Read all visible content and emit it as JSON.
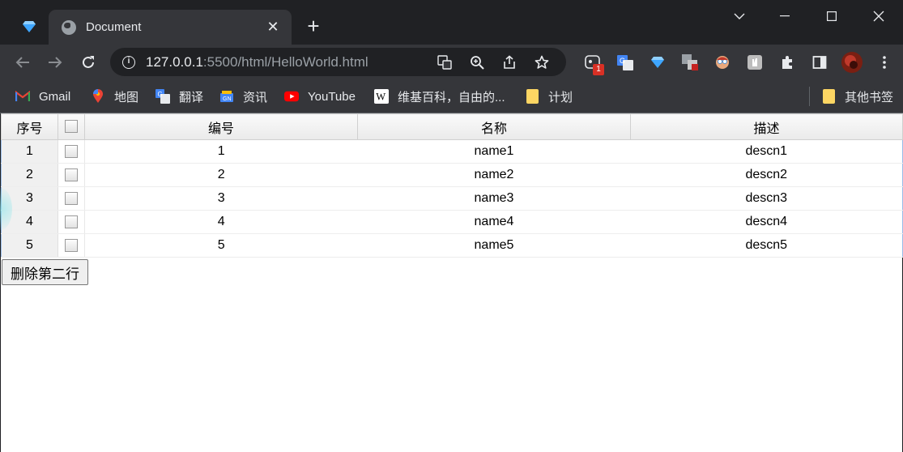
{
  "browser": {
    "tab_title": "Document",
    "url_host": "127.0.0.1",
    "url_rest": ":5500/html/HelloWorld.html",
    "ext_badge": "1",
    "bookmarks": [
      {
        "label": "Gmail",
        "icon": "gmail-icon"
      },
      {
        "label": "地图",
        "icon": "maps-icon"
      },
      {
        "label": "翻译",
        "icon": "translate-icon"
      },
      {
        "label": "资讯",
        "icon": "news-icon"
      },
      {
        "label": "YouTube",
        "icon": "youtube-icon"
      },
      {
        "label": "维基百科，自由的...",
        "icon": "wikipedia-icon"
      },
      {
        "label": "计划",
        "icon": "folder-icon"
      }
    ],
    "other_bookmarks": "其他书签"
  },
  "grid": {
    "headers": {
      "rownum": "序号",
      "id": "编号",
      "name": "名称",
      "desc": "描述"
    },
    "rows": [
      {
        "rownum": "1",
        "id": "1",
        "name": "name1",
        "desc": "descn1"
      },
      {
        "rownum": "2",
        "id": "2",
        "name": "name2",
        "desc": "descn2"
      },
      {
        "rownum": "3",
        "id": "3",
        "name": "name3",
        "desc": "descn3"
      },
      {
        "rownum": "4",
        "id": "4",
        "name": "name4",
        "desc": "descn4"
      },
      {
        "rownum": "5",
        "id": "5",
        "name": "name5",
        "desc": "descn5"
      }
    ]
  },
  "actions": {
    "delete_second_row": "删除第二行"
  },
  "colors": {
    "chrome_dark": "#202124",
    "toolbar": "#35363a",
    "grid_border": "#99bbe8"
  }
}
